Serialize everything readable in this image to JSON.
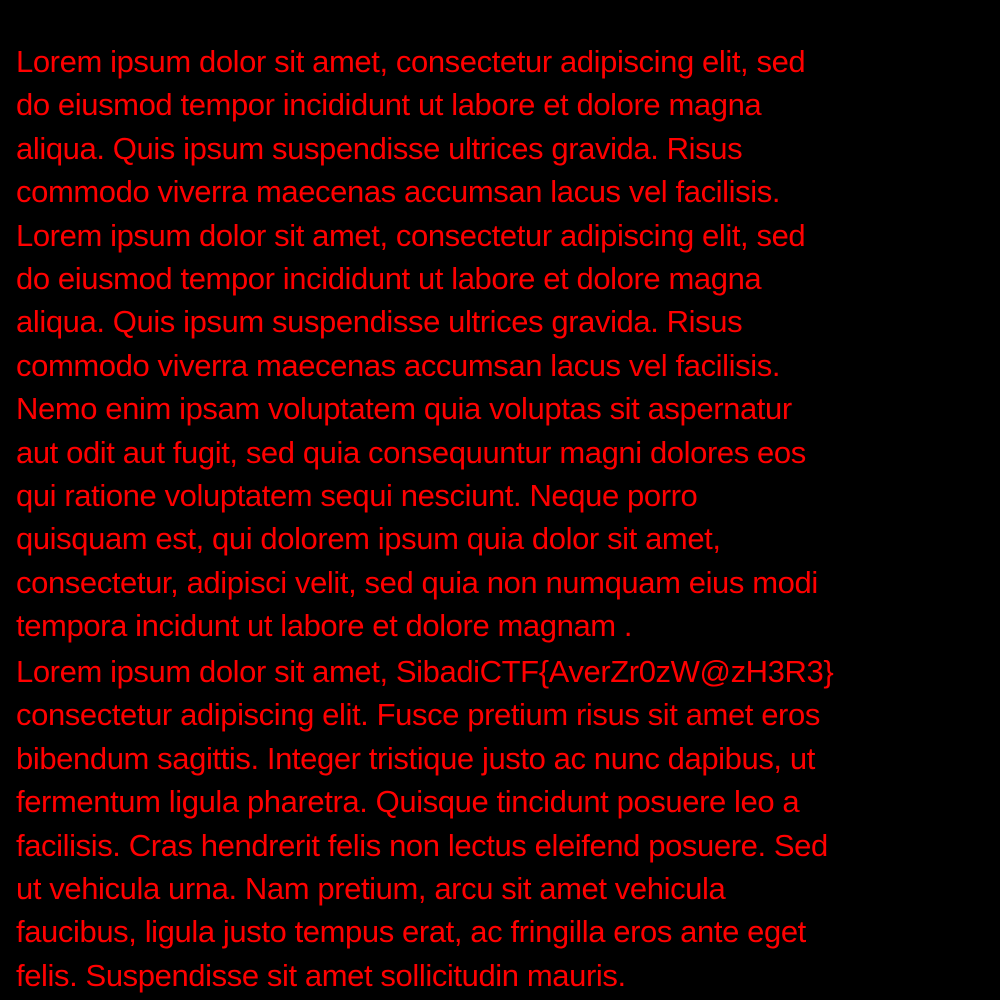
{
  "colors": {
    "background": "#000000",
    "text": "#ff0000"
  },
  "paragraphs": [
    {
      "lines": [
        "Lorem ipsum dolor sit amet, consectetur adipiscing elit, sed",
        "do eiusmod tempor incididunt ut labore et dolore magna",
        "aliqua. Quis ipsum suspendisse ultrices gravida. Risus",
        "commodo viverra maecenas accumsan lacus vel facilisis.",
        "Lorem ipsum dolor sit amet, consectetur adipiscing elit, sed",
        "do eiusmod tempor incididunt ut labore et dolore magna",
        "aliqua. Quis ipsum suspendisse ultrices gravida. Risus",
        "commodo viverra maecenas accumsan lacus vel facilisis.",
        "Nemo enim ipsam voluptatem quia voluptas sit aspernatur",
        "aut odit aut fugit, sed quia consequuntur magni dolores eos",
        "qui ratione voluptatem sequi nesciunt. Neque porro",
        "quisquam est, qui dolorem ipsum quia dolor sit amet,",
        "consectetur, adipisci velit, sed quia non numquam eius modi",
        "tempora incidunt ut labore et dolore magnam ."
      ]
    },
    {
      "lines": [
        "Lorem ipsum dolor sit amet, SibadiCTF{AverZr0zW@zH3R3}",
        "consectetur adipiscing elit. Fusce pretium risus sit amet eros",
        "bibendum sagittis. Integer tristique justo ac nunc dapibus, ut",
        "fermentum ligula pharetra. Quisque tincidunt posuere leo a",
        "facilisis. Cras hendrerit felis non lectus eleifend posuere. Sed",
        "ut vehicula urna. Nam pretium, arcu sit amet vehicula",
        "faucibus, ligula justo tempus erat, ac fringilla eros ante eget",
        "felis. Suspendisse sit amet sollicitudin mauris."
      ]
    }
  ]
}
